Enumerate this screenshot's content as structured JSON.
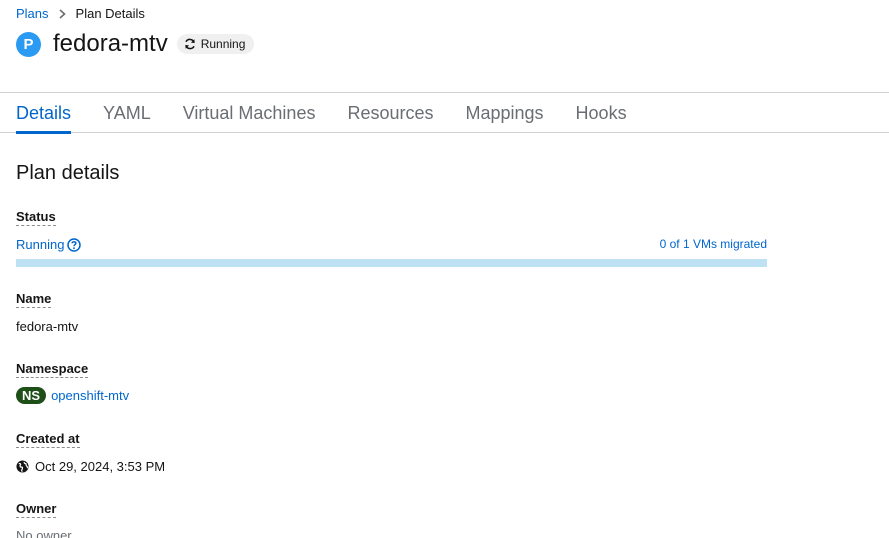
{
  "breadcrumb": {
    "parent": "Plans",
    "current": "Plan Details"
  },
  "header": {
    "badge": "P",
    "title": "fedora-mtv",
    "status": "Running",
    "badge_color": "#2b9af3"
  },
  "tabs": [
    "Details",
    "YAML",
    "Virtual Machines",
    "Resources",
    "Mappings",
    "Hooks"
  ],
  "active_tab": "Details",
  "section_title": "Plan details",
  "fields": {
    "status": {
      "label": "Status",
      "value": "Running",
      "progress_text": "0 of 1 VMs migrated",
      "progress_fraction": 0
    },
    "name": {
      "label": "Name",
      "value": "fedora-mtv"
    },
    "namespace": {
      "label": "Namespace",
      "badge": "NS",
      "value": "openshift-mtv"
    },
    "created": {
      "label": "Created at",
      "value": "Oct 29, 2024, 3:53 PM"
    },
    "owner": {
      "label": "Owner",
      "value": "No owner"
    }
  },
  "colors": {
    "link": "#0066cc",
    "ns_badge": "#1e4f18",
    "progress_track": "#bee1f4"
  },
  "icons": {
    "breadcrumb_separator": "chevron-right-icon",
    "status": "sync-icon",
    "help": "help-circle-icon",
    "created": "globe-icon"
  }
}
